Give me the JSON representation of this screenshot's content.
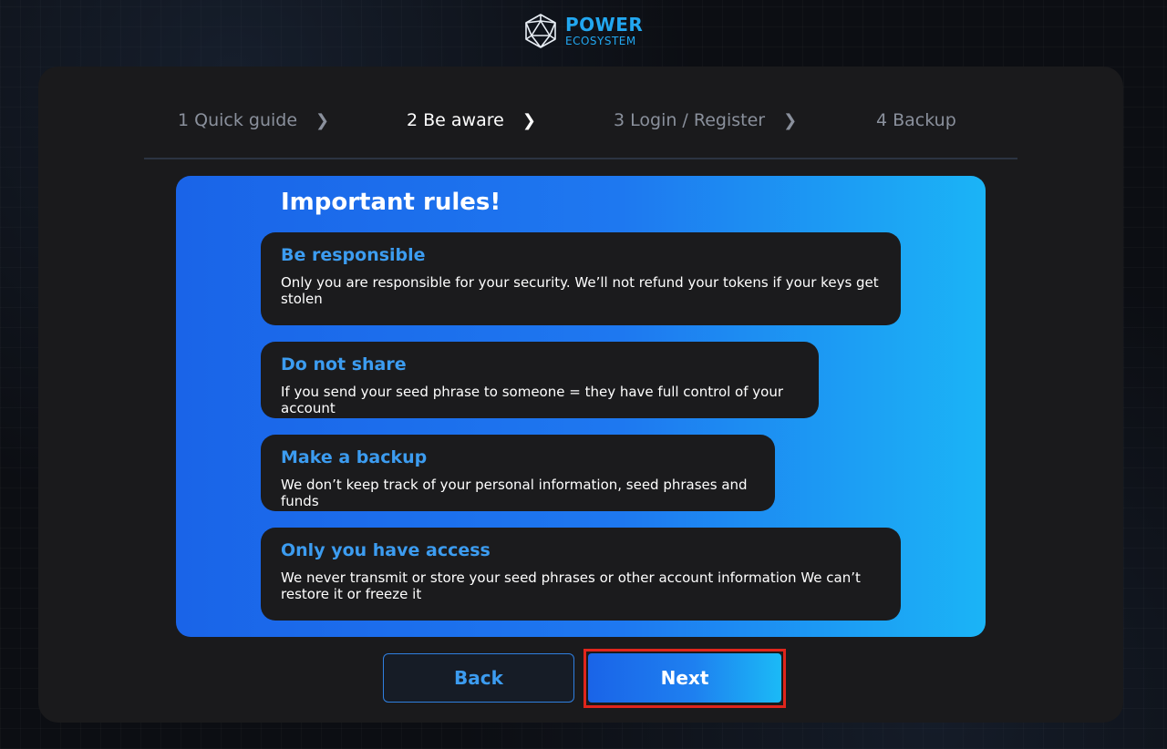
{
  "brand": {
    "line1": "POWER",
    "line2": "ECOSYSTEM"
  },
  "steps": [
    {
      "label": "1 Quick guide",
      "active": false
    },
    {
      "label": "2 Be aware",
      "active": true
    },
    {
      "label": "3 Login / Register",
      "active": false
    },
    {
      "label": "4 Backup",
      "active": false
    }
  ],
  "panel": {
    "title": "Important rules!",
    "rules": [
      {
        "title": "Be responsible",
        "body": "Only you are responsible for your security. We’ll not refund your tokens if your keys get stolen"
      },
      {
        "title": "Do not share",
        "body": "If you send your seed phrase to someone = they have full control of your account"
      },
      {
        "title": "Make a backup",
        "body": "We don’t keep track of your personal information, seed phrases and funds"
      },
      {
        "title": "Only you have access",
        "body": "We never transmit or store your seed phrases or other account information We can’t restore it or freeze it"
      }
    ]
  },
  "buttons": {
    "back": "Back",
    "next": "Next"
  },
  "icons": {
    "logo": "geodesic-sphere-icon",
    "step_separator": "chevron-right-icon"
  },
  "colors": {
    "accent": "#22a7f0",
    "panel_start": "#1a64e8",
    "panel_end": "#1bb4f6",
    "highlight": "#e0251c"
  }
}
